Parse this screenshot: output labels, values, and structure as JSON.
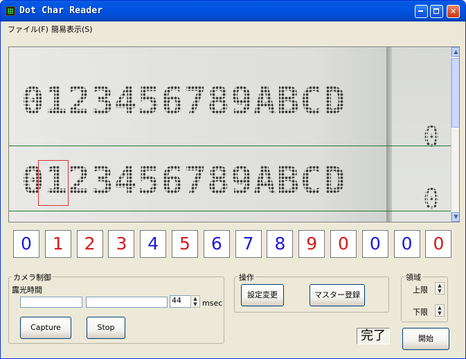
{
  "window": {
    "title": "Dot Char Reader"
  },
  "menu": {
    "items": [
      "ファイル(F)",
      "簡易表示(S)"
    ]
  },
  "viewer": {
    "row1_text": "0123456789ABCD",
    "row2_text": "0123456789ABCD",
    "side_char_1": "0",
    "side_char_2": "0"
  },
  "digits": [
    {
      "value": "0",
      "color": "#1a1ad6"
    },
    {
      "value": "1",
      "color": "#d61a1a"
    },
    {
      "value": "2",
      "color": "#d61a1a"
    },
    {
      "value": "3",
      "color": "#d61a1a"
    },
    {
      "value": "4",
      "color": "#1a1ad6"
    },
    {
      "value": "5",
      "color": "#d61a1a"
    },
    {
      "value": "6",
      "color": "#1a1ad6"
    },
    {
      "value": "7",
      "color": "#1a1ad6"
    },
    {
      "value": "8",
      "color": "#1a1ad6"
    },
    {
      "value": "9",
      "color": "#d61a1a"
    },
    {
      "value": "0",
      "color": "#d61a1a"
    },
    {
      "value": "0",
      "color": "#1a1ad6"
    },
    {
      "value": "0",
      "color": "#1a1ad6"
    },
    {
      "value": "0",
      "color": "#d61a1a"
    }
  ],
  "camera": {
    "legend": "カメラ制御",
    "exposure_label": "露光時間",
    "exposure_value": "44",
    "exposure_unit": "msec",
    "capture_label": "Capture",
    "stop_label": "Stop"
  },
  "operation": {
    "legend": "操作",
    "settings_label": "設定変更",
    "master_label": "マスター登録"
  },
  "region": {
    "legend": "領域",
    "upper_label": "上限",
    "lower_label": "下限"
  },
  "status": {
    "text": "完了"
  },
  "start": {
    "label": "開始"
  },
  "colors": {
    "title_bar": "#0054e3",
    "blue_digit": "#1a1ad6",
    "red_digit": "#d61a1a",
    "guide_line": "#1e7a2e",
    "marker": "#e03030"
  }
}
